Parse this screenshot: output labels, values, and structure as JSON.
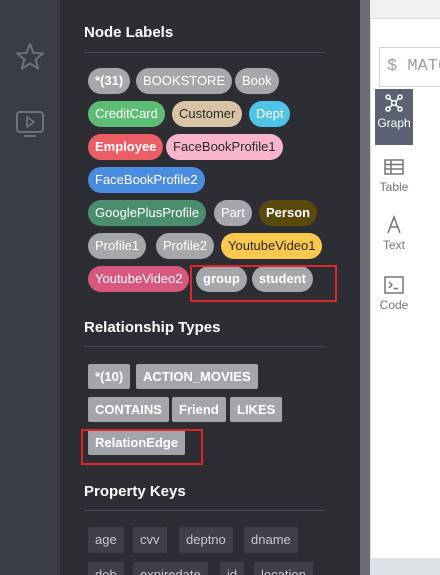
{
  "sidebar": {
    "icons": [
      "star-icon",
      "monitor-play-icon"
    ]
  },
  "node_labels": {
    "title": "Node Labels",
    "labels": [
      {
        "text": "*(31)",
        "color": "#a5a7ab",
        "bold": true
      },
      {
        "text": "BOOKSTORE",
        "color": "#a5a7ab",
        "bold": false
      },
      {
        "text": "Book",
        "color": "#a5a7ab",
        "bold": false
      },
      {
        "text": "CreditCard",
        "color": "#5ebd74",
        "bold": false
      },
      {
        "text": "Customer",
        "color": "#d8c3a5",
        "bold": false
      },
      {
        "text": "Dept",
        "color": "#50c3e6",
        "bold": false
      },
      {
        "text": "Employee",
        "color": "#ec5e65",
        "bold": true
      },
      {
        "text": "FaceBookProfile1",
        "color": "#f7b5cc",
        "bold": false
      },
      {
        "text": "FaceBookProfile2",
        "color": "#4a8de0",
        "bold": false
      },
      {
        "text": "GooglePlusProfile",
        "color": "#4b8e6e",
        "bold": false
      },
      {
        "text": "Part",
        "color": "#a5a7ab",
        "bold": false
      },
      {
        "text": "Person",
        "color": "#5a4a0e",
        "bold": true
      },
      {
        "text": "Profile1",
        "color": "#a5a7ab",
        "bold": false
      },
      {
        "text": "Profile2",
        "color": "#a5a7ab",
        "bold": false
      },
      {
        "text": "YoutubeVideo1",
        "color": "#fbc84f",
        "bold": false
      },
      {
        "text": "YoutubeVideo2",
        "color": "#d9577f",
        "bold": false
      },
      {
        "text": "group",
        "color": "#a5a7ab",
        "bold": true
      },
      {
        "text": "student",
        "color": "#a5a7ab",
        "bold": true
      }
    ]
  },
  "relationship_types": {
    "title": "Relationship Types",
    "types": [
      "*(10)",
      "ACTION_MOVIES",
      "CONTAINS",
      "Friend",
      "LIKES",
      "RelationEdge"
    ]
  },
  "property_keys": {
    "title": "Property Keys",
    "keys": [
      "age",
      "cvv",
      "deptno",
      "dname",
      "dob",
      "expiredate",
      "id",
      "location"
    ]
  },
  "right_panel": {
    "editor_text": "$ MATC",
    "view_tabs": [
      {
        "label": "Graph",
        "icon": "graph-icon",
        "active": true
      },
      {
        "label": "Table",
        "icon": "table-icon",
        "active": false
      },
      {
        "label": "Text",
        "icon": "text-icon",
        "active": false
      },
      {
        "label": "Code",
        "icon": "code-icon",
        "active": false
      }
    ]
  }
}
